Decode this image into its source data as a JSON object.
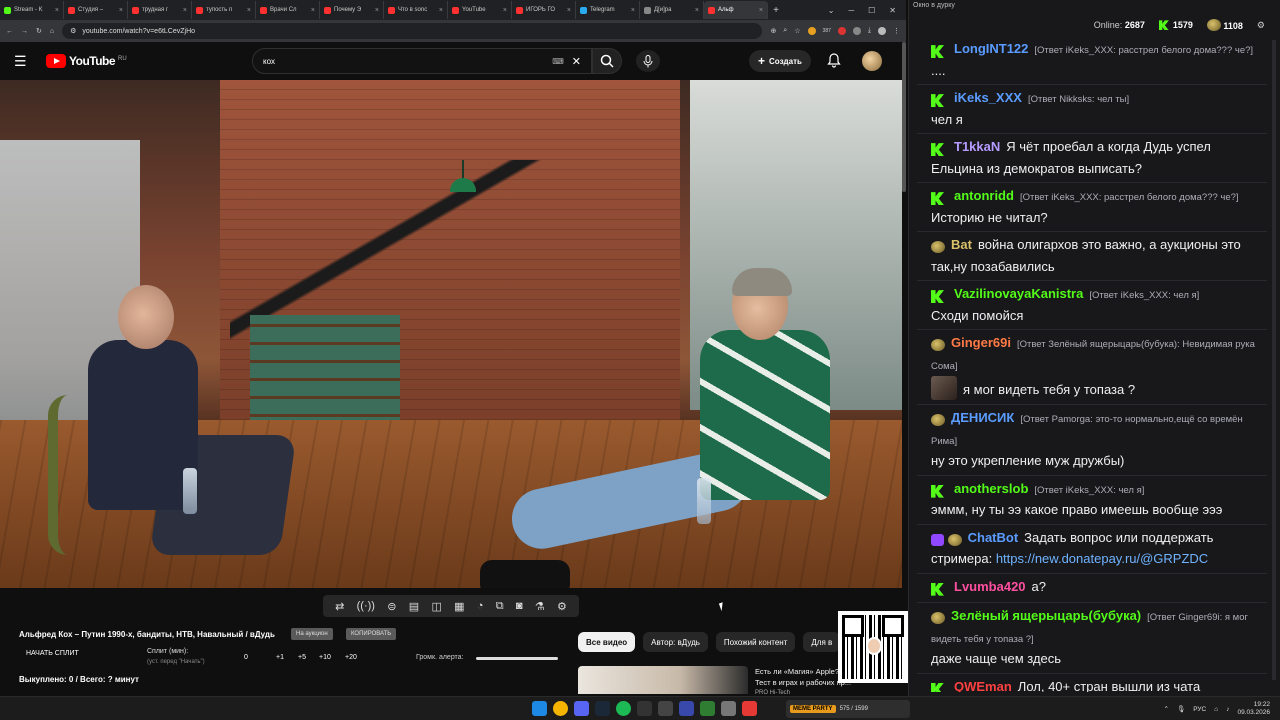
{
  "browser": {
    "tabs": [
      {
        "label": "Stream - K",
        "color": "#53fc18"
      },
      {
        "label": "Студия –",
        "color": "#ff3030"
      },
      {
        "label": "трудная г",
        "color": "#ff3030"
      },
      {
        "label": "тупость п",
        "color": "#ff3030"
      },
      {
        "label": "Врачи Сл",
        "color": "#ff3030"
      },
      {
        "label": "Почему Э",
        "color": "#ff3030"
      },
      {
        "label": "Что в sonс",
        "color": "#ff3030"
      },
      {
        "label": "YouTube",
        "color": "#ff3030"
      },
      {
        "label": "ИГОРЬ ГО",
        "color": "#ff3030"
      },
      {
        "label": "Telegram",
        "color": "#2aabee"
      },
      {
        "label": "Д[и]ра",
        "color": "#888888"
      },
      {
        "label": "Альф",
        "color": "#ff3030",
        "active": true
      }
    ],
    "url": "youtube.com/watch?v=e6tLCevZjHo",
    "ext_badge_1": "387",
    "ext_badge_2": "7"
  },
  "youtube": {
    "logo_word": "YouTube",
    "logo_region": "RU",
    "search_value": "кох",
    "create_label": "Создать",
    "video_title": "Альфред Кох – Путин 1990-х, бандиты, НТВ, Навальный / вДудь",
    "pill_auction": "На аукцион",
    "pill_copy": "КОПИРОВАТЬ",
    "split_button": "НАЧАТЬ СПЛИТ",
    "split_label": "Сплит (мин):",
    "split_hint": "(уст. перед \"Начать\")",
    "split_values": [
      "0",
      "+1",
      "+5",
      "+10",
      "+20"
    ],
    "alert_volume_label": "Громк. алерта:",
    "bought_text": "Выкуплено: 0 / Всего: ? минут",
    "chips": [
      "Все видео",
      "Автор: вДудь",
      "Похожий контент",
      "Для в"
    ],
    "rec_title": "Есть ли «Магия» Apple? Тест в играх и рабочих пр...",
    "rec_channel": "PRO Hi-Tech"
  },
  "chat": {
    "window_title": "Окно в дурку",
    "online_label": "Online:",
    "online_count": "2687",
    "kick_count": "1579",
    "other_count": "1108",
    "messages": [
      {
        "user": "LongINT122",
        "color": "#5a9cff",
        "badge": "kick",
        "reply": "[Ответ iKeks_XXX: расстрел белого дома??? че?]",
        "text": "...."
      },
      {
        "user": "iKeks_XXX",
        "color": "#5a9cff",
        "badge": "kick",
        "reply": "[Ответ Nikksks: чел ты]",
        "text": "чел я"
      },
      {
        "user": "T1kkaN",
        "color": "#b59bff",
        "badge": "kick",
        "reply": "",
        "text": "Я чёт проебал а когда Дудь успел Ельцина из демократов выписать?"
      },
      {
        "user": "antonridd",
        "color": "#53fc18",
        "badge": "kick",
        "reply": "[Ответ iKeks_XXX: расстрел белого дома??? че?]",
        "text": "Историю не читал?"
      },
      {
        "user": "Bat",
        "color": "#d9c16a",
        "badge": "avatar",
        "reply": "",
        "text": "война олигархов это важно, а аукционы это так,ну позабавились"
      },
      {
        "user": "VazilinovayaKanistra",
        "color": "#53fc18",
        "badge": "kick",
        "reply": "[Ответ iKeks_XXX: чел я]",
        "text": "Сходи помойся"
      },
      {
        "user": "Ginger69i",
        "color": "#ff7a45",
        "badge": "avatar",
        "reply": "[Ответ Зелёный ящерыцарь(бубука): Невидимая рука Сома]",
        "text": "я мог видеть тебя у топаза ?"
      },
      {
        "user": "ДЕНИСИК",
        "color": "#5a9cff",
        "badge": "avatar",
        "reply": "[Ответ Pamorga: это-то нормально,ещё со времён Рима]",
        "text": "ну это укрепление муж дружбы)"
      },
      {
        "user": "anotherslob",
        "color": "#53fc18",
        "badge": "kick",
        "reply": "[Ответ iKeks_XXX: чел я]",
        "text": "эммм, ну ты ээ какое право имеешь вообще эээ"
      },
      {
        "user": "ChatBot",
        "color": "#5a9cff",
        "badge": "bot",
        "reply": "",
        "text": "Задать вопрос или поддержать стримера:",
        "link": "https://new.donatepay.ru/@GRPZDC"
      },
      {
        "user": "Lvumba420",
        "color": "#ff4fa0",
        "badge": "kick",
        "reply": "",
        "text": "а?"
      },
      {
        "user": "Зелёный ящерыцарь(бубука)",
        "color": "#53fc18",
        "badge": "avatar",
        "reply": "[Ответ Ginger69i: я мог видеть тебя у топаза ?]",
        "text": "даже чаще чем здесь"
      },
      {
        "user": "QWEman",
        "color": "#ff4040",
        "badge": "kick",
        "reply": "",
        "text": "Лол, 40+ стран вышли из чата"
      }
    ]
  },
  "taskbar": {
    "media_label": "MEME PARTY",
    "media_progress": "575 / 1599",
    "lang": "РУС",
    "time": "19:22",
    "date": "09.03.2026"
  }
}
